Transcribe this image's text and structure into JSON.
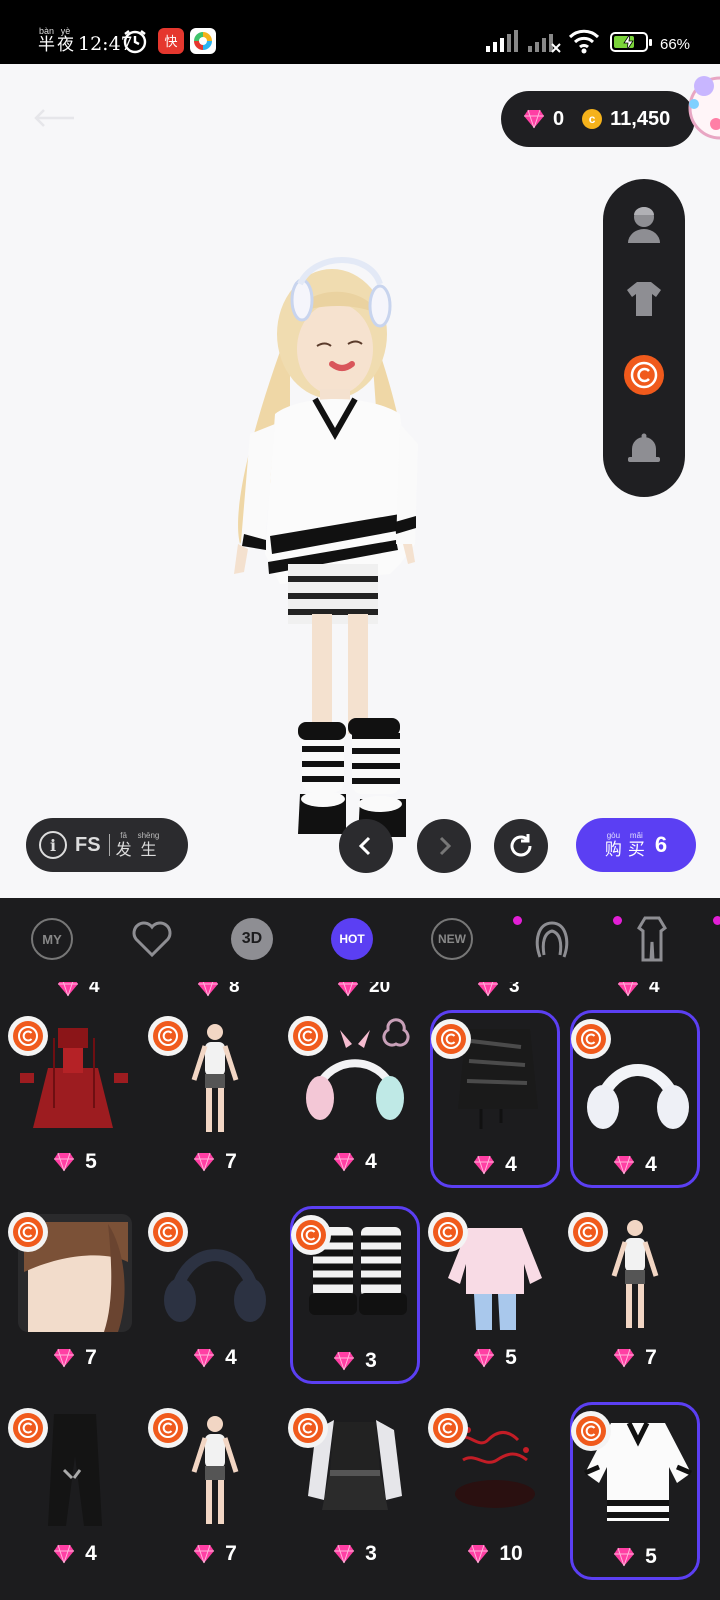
{
  "status_bar": {
    "time_pinyin_1": "bàn",
    "time_hanzi_1": "半",
    "time_pinyin_2": "yè",
    "time_hanzi_2": "夜",
    "time": "12:47",
    "battery_percent": "66%",
    "battery_level": 0.66,
    "icons": [
      "alarm-icon",
      "red-app-icon",
      "multicolor-app-icon",
      "signal-icon",
      "signal-x-icon",
      "wifi-icon",
      "battery-charging-icon"
    ]
  },
  "header": {
    "gem_balance": "0",
    "coin_symbol": "c",
    "coin_balance": "11,450"
  },
  "side_rail": {
    "items": [
      "head-icon",
      "shirt-icon",
      "copyright-icon",
      "bell-icon"
    ],
    "active_index": 2
  },
  "controls": {
    "info_fs": "FS",
    "info_pinyin_1": "fā",
    "info_hanzi_1": "发",
    "info_pinyin_2": "shēng",
    "info_hanzi_2": "生",
    "buy_pinyin_1": "gòu",
    "buy_hanzi_1": "购",
    "buy_pinyin_2": "mǎi",
    "buy_hanzi_2": "买",
    "buy_count": "6"
  },
  "tabs": {
    "my": "MY",
    "three_d": "3D",
    "hot": "HOT",
    "new": "NEW",
    "active": "hot"
  },
  "prev_row": [
    "4",
    "8",
    "20",
    "3",
    "4"
  ],
  "colors": {
    "accent": "#5b3ff3",
    "badge": "#f05a1c",
    "gem": "#ff3fa4",
    "coin": "#f5b21b",
    "panel": "#1c1c1e"
  },
  "items": [
    {
      "name": "red lolita dress",
      "price": "5",
      "selected": false
    },
    {
      "name": "base body",
      "price": "7",
      "selected": false
    },
    {
      "name": "bunny headphones",
      "price": "4",
      "selected": false
    },
    {
      "name": "black leather skirt",
      "price": "4",
      "selected": true
    },
    {
      "name": "white headphones",
      "price": "4",
      "selected": true
    },
    {
      "name": "brown ponytail hair",
      "price": "7",
      "selected": false
    },
    {
      "name": "navy headphones",
      "price": "4",
      "selected": false
    },
    {
      "name": "striped leg warmers",
      "price": "3",
      "selected": true
    },
    {
      "name": "pink jacket and jeans",
      "price": "5",
      "selected": false
    },
    {
      "name": "base body",
      "price": "7",
      "selected": false
    },
    {
      "name": "black cargo pants",
      "price": "4",
      "selected": false
    },
    {
      "name": "base body",
      "price": "7",
      "selected": false
    },
    {
      "name": "black and white dress",
      "price": "3",
      "selected": false
    },
    {
      "name": "red effect",
      "price": "10",
      "selected": false
    },
    {
      "name": "striped white sweater",
      "price": "5",
      "selected": true
    }
  ]
}
